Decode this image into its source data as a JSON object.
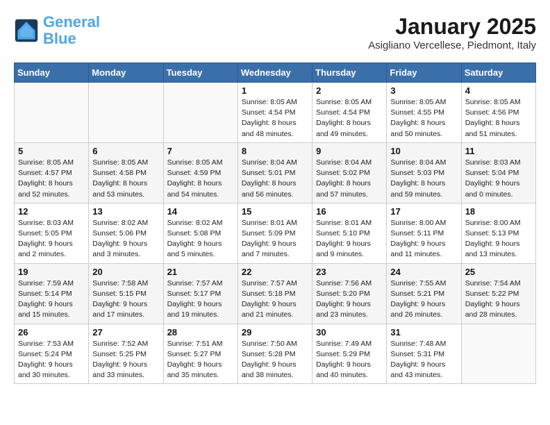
{
  "header": {
    "logo_general": "General",
    "logo_blue": "Blue",
    "month": "January 2025",
    "location": "Asigliano Vercellese, Piedmont, Italy"
  },
  "days_of_week": [
    "Sunday",
    "Monday",
    "Tuesday",
    "Wednesday",
    "Thursday",
    "Friday",
    "Saturday"
  ],
  "weeks": [
    [
      {
        "num": "",
        "info": ""
      },
      {
        "num": "",
        "info": ""
      },
      {
        "num": "",
        "info": ""
      },
      {
        "num": "1",
        "info": "Sunrise: 8:05 AM\nSunset: 4:54 PM\nDaylight: 8 hours\nand 48 minutes."
      },
      {
        "num": "2",
        "info": "Sunrise: 8:05 AM\nSunset: 4:54 PM\nDaylight: 8 hours\nand 49 minutes."
      },
      {
        "num": "3",
        "info": "Sunrise: 8:05 AM\nSunset: 4:55 PM\nDaylight: 8 hours\nand 50 minutes."
      },
      {
        "num": "4",
        "info": "Sunrise: 8:05 AM\nSunset: 4:56 PM\nDaylight: 8 hours\nand 51 minutes."
      }
    ],
    [
      {
        "num": "5",
        "info": "Sunrise: 8:05 AM\nSunset: 4:57 PM\nDaylight: 8 hours\nand 52 minutes."
      },
      {
        "num": "6",
        "info": "Sunrise: 8:05 AM\nSunset: 4:58 PM\nDaylight: 8 hours\nand 53 minutes."
      },
      {
        "num": "7",
        "info": "Sunrise: 8:05 AM\nSunset: 4:59 PM\nDaylight: 8 hours\nand 54 minutes."
      },
      {
        "num": "8",
        "info": "Sunrise: 8:04 AM\nSunset: 5:01 PM\nDaylight: 8 hours\nand 56 minutes."
      },
      {
        "num": "9",
        "info": "Sunrise: 8:04 AM\nSunset: 5:02 PM\nDaylight: 8 hours\nand 57 minutes."
      },
      {
        "num": "10",
        "info": "Sunrise: 8:04 AM\nSunset: 5:03 PM\nDaylight: 8 hours\nand 59 minutes."
      },
      {
        "num": "11",
        "info": "Sunrise: 8:03 AM\nSunset: 5:04 PM\nDaylight: 9 hours\nand 0 minutes."
      }
    ],
    [
      {
        "num": "12",
        "info": "Sunrise: 8:03 AM\nSunset: 5:05 PM\nDaylight: 9 hours\nand 2 minutes."
      },
      {
        "num": "13",
        "info": "Sunrise: 8:02 AM\nSunset: 5:06 PM\nDaylight: 9 hours\nand 3 minutes."
      },
      {
        "num": "14",
        "info": "Sunrise: 8:02 AM\nSunset: 5:08 PM\nDaylight: 9 hours\nand 5 minutes."
      },
      {
        "num": "15",
        "info": "Sunrise: 8:01 AM\nSunset: 5:09 PM\nDaylight: 9 hours\nand 7 minutes."
      },
      {
        "num": "16",
        "info": "Sunrise: 8:01 AM\nSunset: 5:10 PM\nDaylight: 9 hours\nand 9 minutes."
      },
      {
        "num": "17",
        "info": "Sunrise: 8:00 AM\nSunset: 5:11 PM\nDaylight: 9 hours\nand 11 minutes."
      },
      {
        "num": "18",
        "info": "Sunrise: 8:00 AM\nSunset: 5:13 PM\nDaylight: 9 hours\nand 13 minutes."
      }
    ],
    [
      {
        "num": "19",
        "info": "Sunrise: 7:59 AM\nSunset: 5:14 PM\nDaylight: 9 hours\nand 15 minutes."
      },
      {
        "num": "20",
        "info": "Sunrise: 7:58 AM\nSunset: 5:15 PM\nDaylight: 9 hours\nand 17 minutes."
      },
      {
        "num": "21",
        "info": "Sunrise: 7:57 AM\nSunset: 5:17 PM\nDaylight: 9 hours\nand 19 minutes."
      },
      {
        "num": "22",
        "info": "Sunrise: 7:57 AM\nSunset: 5:18 PM\nDaylight: 9 hours\nand 21 minutes."
      },
      {
        "num": "23",
        "info": "Sunrise: 7:56 AM\nSunset: 5:20 PM\nDaylight: 9 hours\nand 23 minutes."
      },
      {
        "num": "24",
        "info": "Sunrise: 7:55 AM\nSunset: 5:21 PM\nDaylight: 9 hours\nand 26 minutes."
      },
      {
        "num": "25",
        "info": "Sunrise: 7:54 AM\nSunset: 5:22 PM\nDaylight: 9 hours\nand 28 minutes."
      }
    ],
    [
      {
        "num": "26",
        "info": "Sunrise: 7:53 AM\nSunset: 5:24 PM\nDaylight: 9 hours\nand 30 minutes."
      },
      {
        "num": "27",
        "info": "Sunrise: 7:52 AM\nSunset: 5:25 PM\nDaylight: 9 hours\nand 33 minutes."
      },
      {
        "num": "28",
        "info": "Sunrise: 7:51 AM\nSunset: 5:27 PM\nDaylight: 9 hours\nand 35 minutes."
      },
      {
        "num": "29",
        "info": "Sunrise: 7:50 AM\nSunset: 5:28 PM\nDaylight: 9 hours\nand 38 minutes."
      },
      {
        "num": "30",
        "info": "Sunrise: 7:49 AM\nSunset: 5:29 PM\nDaylight: 9 hours\nand 40 minutes."
      },
      {
        "num": "31",
        "info": "Sunrise: 7:48 AM\nSunset: 5:31 PM\nDaylight: 9 hours\nand 43 minutes."
      },
      {
        "num": "",
        "info": ""
      }
    ]
  ]
}
